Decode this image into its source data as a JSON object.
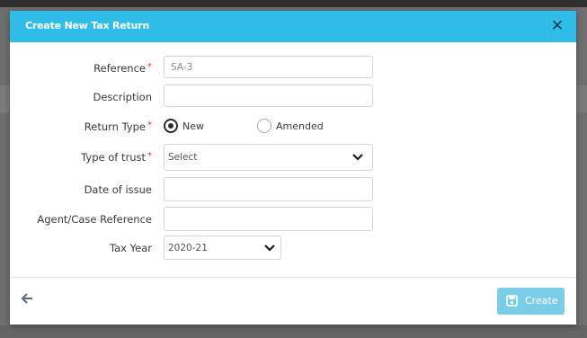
{
  "modal": {
    "title": "Create New Tax Return",
    "close_icon": "close-x-icon"
  },
  "form": {
    "reference": {
      "label": "Reference",
      "required_mark": "*",
      "value": "SA-3"
    },
    "description": {
      "label": "Description",
      "value": ""
    },
    "return_type": {
      "label": "Return Type",
      "required_mark": "*",
      "options": [
        {
          "label": "New",
          "selected": true
        },
        {
          "label": "Amended",
          "selected": false
        }
      ]
    },
    "type_of_trust": {
      "label": "Type of trust",
      "required_mark": "*",
      "selected": "Select"
    },
    "date_of_issue": {
      "label": "Date of issue",
      "value": ""
    },
    "agent_case_reference": {
      "label": "Agent/Case Reference",
      "value": ""
    },
    "tax_year": {
      "label": "Tax Year",
      "selected": "2020-21"
    }
  },
  "footer": {
    "back_icon": "arrow-left-icon",
    "create_label": "Create",
    "create_icon": "save-icon"
  },
  "colors": {
    "header": "#2fbde8",
    "create_button": "#7bcce6",
    "required": "#d9302b"
  }
}
